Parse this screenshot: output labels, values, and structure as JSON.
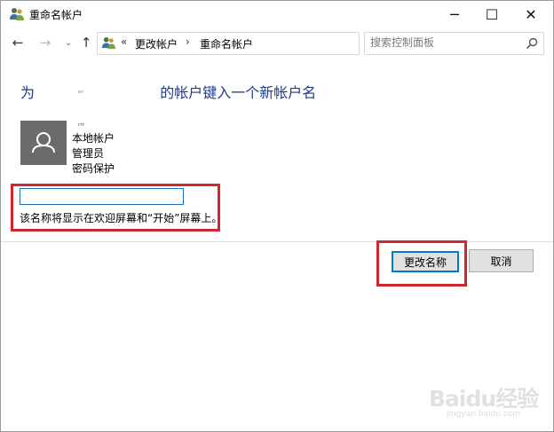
{
  "window": {
    "title": "重命名帐户",
    "controls": {
      "minimize": "─",
      "maximize": "☐",
      "close": "✕"
    }
  },
  "nav": {
    "back": "←",
    "forward": "→",
    "recent": "⌄",
    "up": "↑",
    "breadcrumbs": {
      "overflow": "«",
      "item1": "更改帐户",
      "separator": "›",
      "item2": "重命名帐户"
    },
    "search_placeholder": "搜索控制面板"
  },
  "heading": {
    "prefix": "为",
    "username": "ᵣᵣᵣ",
    "suffix": "的帐户键入一个新帐户名"
  },
  "account": {
    "name": "ᵣᵣᵣ",
    "lines": [
      "本地帐户",
      "管理员",
      "密码保护"
    ]
  },
  "rename": {
    "value": "",
    "hint": "该名称将显示在欢迎屏幕和“开始”屏幕上。"
  },
  "buttons": {
    "change_name": "更改名称",
    "cancel": "取消"
  },
  "watermark": {
    "text": "Baidu经验",
    "sub": "jingyan.baidu.com"
  },
  "colors": {
    "heading": "#1e3b8a",
    "highlight": "#d0262d",
    "focus": "#0078d7",
    "avatar": "#6b6b6b"
  }
}
